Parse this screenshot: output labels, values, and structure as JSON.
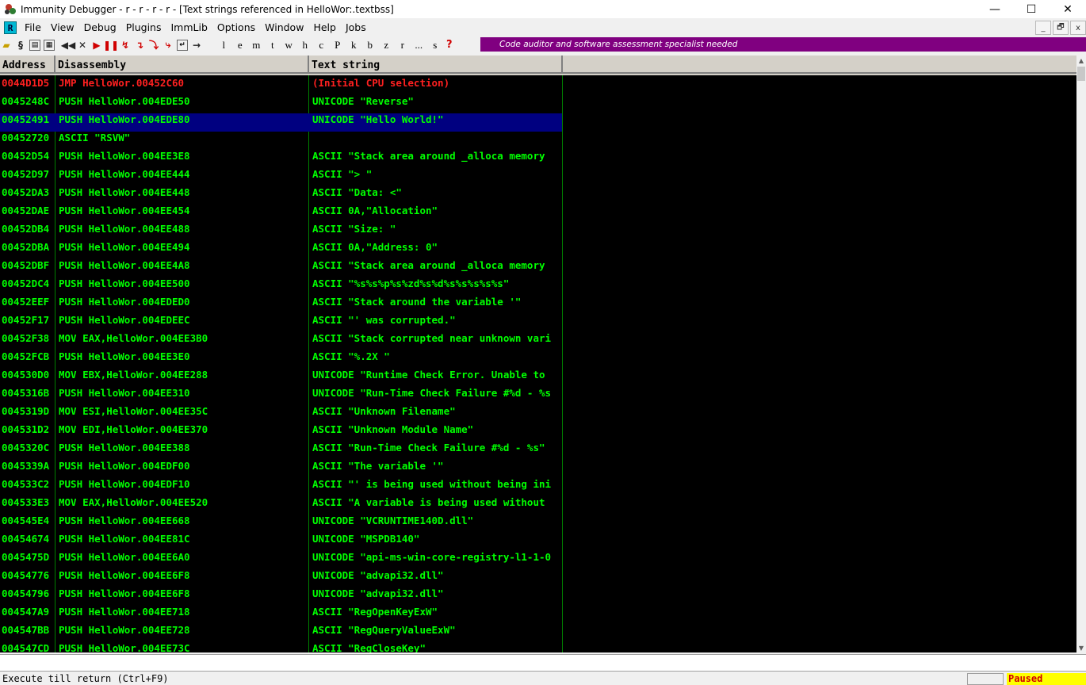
{
  "window": {
    "title": "Immunity Debugger - r - r - r - r  - [Text strings referenced in HelloWor:.textbss]",
    "minimize": "—",
    "maximize": "☐",
    "close": "✕"
  },
  "menu": {
    "items": [
      "File",
      "View",
      "Debug",
      "Plugins",
      "ImmLib",
      "Options",
      "Window",
      "Help",
      "Jobs"
    ],
    "mdi_buttons": [
      "_",
      "🗗",
      "x"
    ]
  },
  "toolbar": {
    "letters": [
      "l",
      "e",
      "m",
      "t",
      "w",
      "h",
      "c",
      "P",
      "k",
      "b",
      "z",
      "r",
      "...",
      "s"
    ],
    "help": "?",
    "banner": "Code auditor and software assessment specialist needed"
  },
  "listing": {
    "headers": {
      "address": "Address",
      "disassembly": "Disassembly",
      "text": "Text string"
    },
    "selected_index": 2,
    "rows": [
      {
        "address": "0044D1D5",
        "disassembly": "JMP HelloWor.00452C60",
        "text": "(Initial CPU selection)",
        "color": "red"
      },
      {
        "address": "0045248C",
        "disassembly": "PUSH HelloWor.004EDE50",
        "text": "UNICODE \"Reverse\""
      },
      {
        "address": "00452491",
        "disassembly": "PUSH HelloWor.004EDE80",
        "text": "UNICODE \"Hello World!\""
      },
      {
        "address": "00452720",
        "disassembly": "ASCII \"RSVW\"",
        "text": ""
      },
      {
        "address": "00452D54",
        "disassembly": "PUSH HelloWor.004EE3E8",
        "text": "ASCII \"Stack area around _alloca memory"
      },
      {
        "address": "00452D97",
        "disassembly": "PUSH HelloWor.004EE444",
        "text": "ASCII \"> \""
      },
      {
        "address": "00452DA3",
        "disassembly": "PUSH HelloWor.004EE448",
        "text": "ASCII \"Data: <\""
      },
      {
        "address": "00452DAE",
        "disassembly": "PUSH HelloWor.004EE454",
        "text": "ASCII 0A,\"Allocation\""
      },
      {
        "address": "00452DB4",
        "disassembly": "PUSH HelloWor.004EE488",
        "text": "ASCII \"Size: \""
      },
      {
        "address": "00452DBA",
        "disassembly": "PUSH HelloWor.004EE494",
        "text": "ASCII 0A,\"Address: 0\""
      },
      {
        "address": "00452DBF",
        "disassembly": "PUSH HelloWor.004EE4A8",
        "text": "ASCII \"Stack area around _alloca memory"
      },
      {
        "address": "00452DC4",
        "disassembly": "PUSH HelloWor.004EE500",
        "text": "ASCII \"%s%s%p%s%zd%s%d%s%s%s%s%s\""
      },
      {
        "address": "00452EEF",
        "disassembly": "PUSH HelloWor.004EDED0",
        "text": "ASCII \"Stack around the variable '\""
      },
      {
        "address": "00452F17",
        "disassembly": "PUSH HelloWor.004EDEEC",
        "text": "ASCII \"' was corrupted.\""
      },
      {
        "address": "00452F38",
        "disassembly": "MOV EAX,HelloWor.004EE3B0",
        "text": "ASCII \"Stack corrupted near unknown vari"
      },
      {
        "address": "00452FCB",
        "disassembly": "PUSH HelloWor.004EE3E0",
        "text": "ASCII \"%.2X \""
      },
      {
        "address": "004530D0",
        "disassembly": "MOV EBX,HelloWor.004EE288",
        "text": "UNICODE \"Runtime Check Error. Unable to"
      },
      {
        "address": "0045316B",
        "disassembly": "PUSH HelloWor.004EE310",
        "text": "UNICODE \"Run-Time Check Failure #%d - %s"
      },
      {
        "address": "0045319D",
        "disassembly": "MOV ESI,HelloWor.004EE35C",
        "text": "ASCII \"Unknown Filename\""
      },
      {
        "address": "004531D2",
        "disassembly": "MOV EDI,HelloWor.004EE370",
        "text": "ASCII \"Unknown Module Name\""
      },
      {
        "address": "0045320C",
        "disassembly": "PUSH HelloWor.004EE388",
        "text": "ASCII \"Run-Time Check Failure #%d - %s\""
      },
      {
        "address": "0045339A",
        "disassembly": "PUSH HelloWor.004EDF00",
        "text": "ASCII \"The variable '\""
      },
      {
        "address": "004533C2",
        "disassembly": "PUSH HelloWor.004EDF10",
        "text": "ASCII \"' is being used without being ini"
      },
      {
        "address": "004533E3",
        "disassembly": "MOV EAX,HelloWor.004EE520",
        "text": "ASCII \"A variable is being used without"
      },
      {
        "address": "004545E4",
        "disassembly": "PUSH HelloWor.004EE668",
        "text": "UNICODE \"VCRUNTIME140D.dll\""
      },
      {
        "address": "00454674",
        "disassembly": "PUSH HelloWor.004EE81C",
        "text": "UNICODE \"MSPDB140\""
      },
      {
        "address": "0045475D",
        "disassembly": "PUSH HelloWor.004EE6A0",
        "text": "UNICODE \"api-ms-win-core-registry-l1-1-0"
      },
      {
        "address": "00454776",
        "disassembly": "PUSH HelloWor.004EE6F8",
        "text": "UNICODE \"advapi32.dll\""
      },
      {
        "address": "00454796",
        "disassembly": "PUSH HelloWor.004EE6F8",
        "text": "UNICODE \"advapi32.dll\""
      },
      {
        "address": "004547A9",
        "disassembly": "PUSH HelloWor.004EE718",
        "text": "ASCII \"RegOpenKeyExW\""
      },
      {
        "address": "004547BB",
        "disassembly": "PUSH HelloWor.004EE728",
        "text": "ASCII \"RegQueryValueExW\""
      },
      {
        "address": "004547CD",
        "disassembly": "PUSH HelloWor.004EE73C",
        "text": "ASCII \"RegCloseKey\""
      }
    ]
  },
  "status": {
    "message": "Execute till return (Ctrl+F9)",
    "state": "Paused"
  },
  "colors": {
    "listing_bg": "#000000",
    "listing_fg": "#00ff00",
    "highlight_red": "#ff2020",
    "selection_bg": "#000080",
    "banner_bg": "#800080",
    "paused_bg": "#ffff00",
    "paused_fg": "#d00000"
  }
}
